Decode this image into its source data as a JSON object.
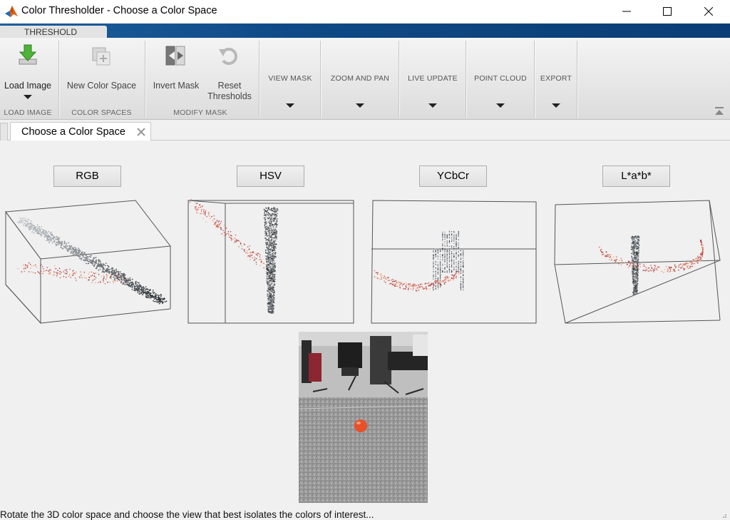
{
  "window": {
    "title": "Color Thresholder - Choose a Color Space",
    "icon": "matlab-logo-icon",
    "controls": [
      "minimize-icon",
      "maximize-icon",
      "close-icon"
    ]
  },
  "ribbon": {
    "active_tab": "THRESHOLD",
    "buttons": {
      "load_image": "Load Image",
      "new_color_space": "New Color Space",
      "invert_mask": "Invert Mask",
      "reset_thresholds_line1": "Reset",
      "reset_thresholds_line2": "Thresholds"
    },
    "group_labels": {
      "load_image": "LOAD IMAGE",
      "color_spaces": "COLOR SPACES",
      "modify_mask": "MODIFY MASK"
    },
    "menus": {
      "view_mask": "VIEW MASK",
      "zoom_and_pan": "ZOOM AND PAN",
      "live_update": "LIVE UPDATE",
      "point_cloud": "POINT CLOUD",
      "export": "EXPORT"
    }
  },
  "document_tab": {
    "label": "Choose a Color Space"
  },
  "color_spaces": {
    "rgb": "RGB",
    "hsv": "HSV",
    "ycbcr": "YCbCr",
    "lab": "L*a*b*"
  },
  "status": {
    "message": "Rotate the 3D color space and choose the view that best isolates the colors of interest..."
  },
  "colors": {
    "accent_blue": "#0f4a86",
    "ribbon_bg": "#e3e3e3",
    "ball_orange": "#e8502a"
  }
}
